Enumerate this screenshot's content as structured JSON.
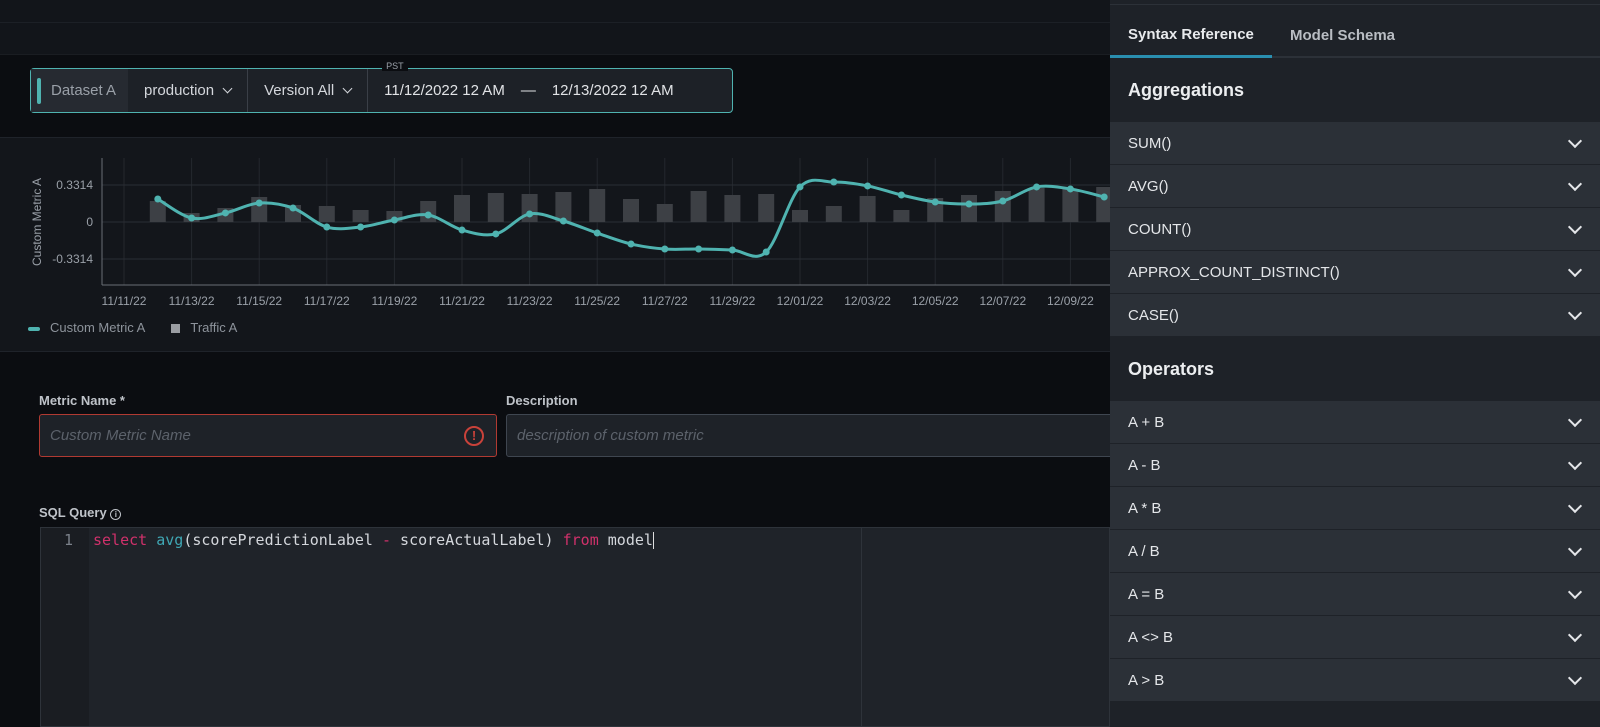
{
  "filter": {
    "dataset": "Dataset A",
    "environment": "production",
    "version": "Version All",
    "timezone": "PST",
    "start": "11/12/2022 12 AM",
    "separator": "—",
    "end": "12/13/2022 12 AM",
    "accent": "#4fb3b0"
  },
  "chart_data": {
    "type": "line+bar",
    "ylabel": "Custom Metric A",
    "yticks": [
      "0.3314",
      "0",
      "-0.3314"
    ],
    "ylim": [
      -0.55,
      0.55
    ],
    "xticks": [
      "11/11/22",
      "11/13/22",
      "11/15/22",
      "11/17/22",
      "11/19/22",
      "11/21/22",
      "11/23/22",
      "11/25/22",
      "11/27/22",
      "11/29/22",
      "12/01/22",
      "12/03/22",
      "12/05/22",
      "12/07/22",
      "12/09/22"
    ],
    "grid": true,
    "legend_position": "bottom-left",
    "x": [
      "11/12",
      "11/13",
      "11/14",
      "11/15",
      "11/16",
      "11/17",
      "11/18",
      "11/19",
      "11/20",
      "11/21",
      "11/22",
      "11/23",
      "11/24",
      "11/25",
      "11/26",
      "11/27",
      "11/28",
      "11/29",
      "11/30",
      "12/01",
      "12/02",
      "12/03",
      "12/04",
      "12/05",
      "12/06",
      "12/07",
      "12/08",
      "12/09",
      "12/10"
    ],
    "series": [
      {
        "name": "Custom Metric A",
        "type": "line",
        "color": "#4fb3b0",
        "values": [
          0.206,
          0.036,
          0.081,
          0.17,
          0.125,
          -0.045,
          -0.045,
          0.018,
          0.063,
          -0.072,
          -0.107,
          0.072,
          0.009,
          -0.099,
          -0.197,
          -0.242,
          -0.242,
          -0.251,
          -0.269,
          0.314,
          0.358,
          0.323,
          0.242,
          0.179,
          0.161,
          0.188,
          0.314,
          0.296,
          0.224
        ]
      },
      {
        "name": "Traffic A",
        "type": "bar",
        "color": "#3d4045",
        "values": [
          21,
          9,
          14,
          25,
          17,
          16,
          12,
          11,
          21,
          27,
          29,
          28,
          30,
          33,
          23,
          18,
          31,
          27,
          28,
          12,
          16,
          26,
          12,
          24,
          27,
          31,
          34,
          33,
          35
        ]
      }
    ]
  },
  "form": {
    "metric_name_label": "Metric Name *",
    "metric_name_placeholder": "Custom Metric Name",
    "description_label": "Description",
    "description_placeholder": "description of custom metric",
    "sql_label": "SQL Query",
    "line_number": "1",
    "code": [
      {
        "t": "select",
        "c": "kw"
      },
      {
        "t": " "
      },
      {
        "t": "avg",
        "c": "fn"
      },
      {
        "t": "(scorePredictionLabel "
      },
      {
        "t": "-",
        "c": "kw"
      },
      {
        "t": " scoreActualLabel) "
      },
      {
        "t": "from",
        "c": "kw"
      },
      {
        "t": " model"
      }
    ]
  },
  "panel": {
    "tabs": [
      "Syntax Reference",
      "Model Schema"
    ],
    "active_tab": "Syntax Reference",
    "sections": [
      {
        "title": "Aggregations",
        "items": [
          "SUM()",
          "AVG()",
          "COUNT()",
          "APPROX_COUNT_DISTINCT()",
          "CASE()"
        ]
      },
      {
        "title": "Operators",
        "items": [
          "A + B",
          "A - B",
          "A * B",
          "A / B",
          "A = B",
          "A <> B",
          "A > B"
        ]
      }
    ]
  }
}
